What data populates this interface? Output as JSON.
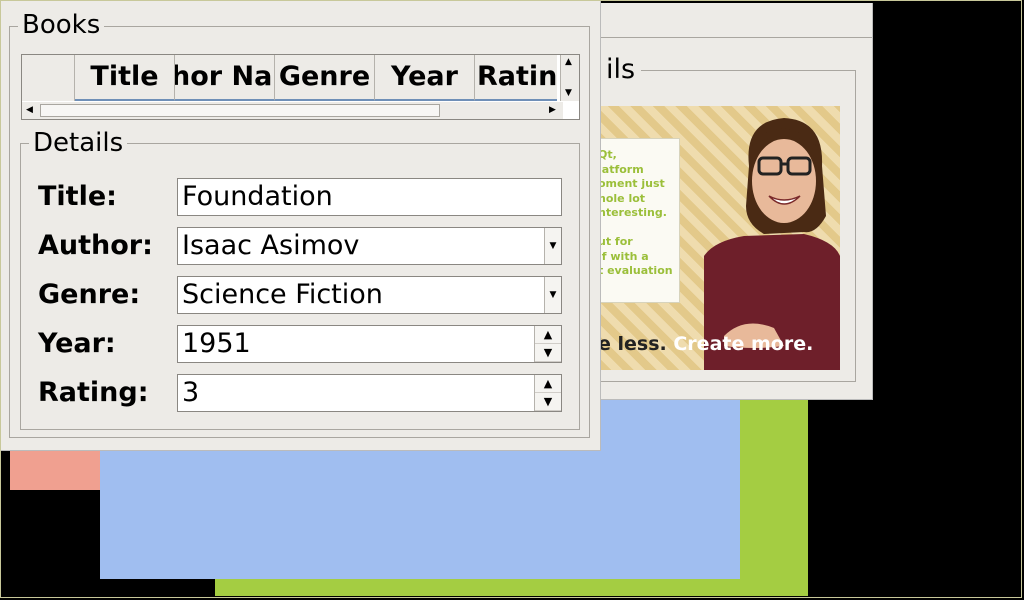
{
  "back_window": {
    "group_title": "ils",
    "poster": {
      "card_text": "Qt,\nlatform\noment just\nhole lot\nnteresting.\n\nut for\nlf with a\nt evaluation",
      "tagline_dark": "e less.",
      "tagline_light": " Create more."
    }
  },
  "books_group": {
    "title": "Books",
    "columns": [
      "Title",
      "hor Na",
      "Genre",
      "Year",
      "Rating"
    ]
  },
  "details": {
    "title": "Details",
    "labels": {
      "title": "Title:",
      "author": "Author:",
      "genre": "Genre:",
      "year": "Year:",
      "rating": "Rating:"
    },
    "values": {
      "title": "Foundation",
      "author": "Isaac Asimov",
      "genre": "Science Fiction",
      "year": "1951",
      "rating": "3"
    }
  },
  "colors": {
    "window_bg": "#edebe7",
    "header_underline": "#6f8fb7",
    "green_block": "#a4cd42",
    "blue_block": "#a0bef0",
    "salmon_block": "#f0a090"
  }
}
